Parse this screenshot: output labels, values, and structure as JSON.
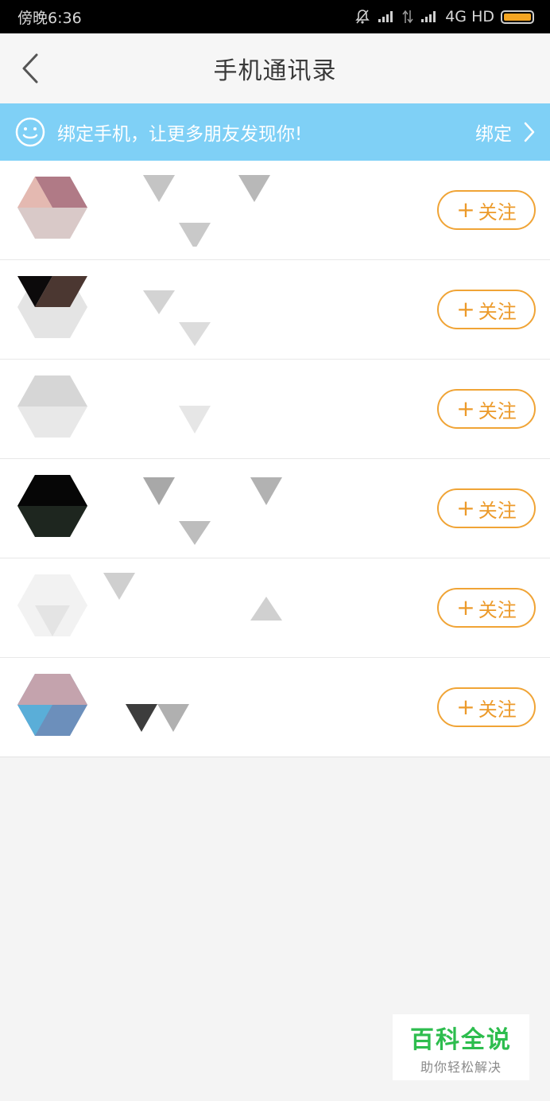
{
  "status_bar": {
    "time": "傍晚6:36",
    "network": "4G HD",
    "battery_color": "#f5a623"
  },
  "nav": {
    "title": "手机通讯录",
    "back_icon": "chevron-left-icon"
  },
  "banner": {
    "message": "绑定手机，让更多朋友发现你!",
    "action_label": "绑定",
    "icon": "smile-icon",
    "background": "#7fd0f6"
  },
  "contacts": [
    {
      "follow_label": "关注",
      "avatar_colors": [
        "#b07a86",
        "#e4b9b1",
        "#d9c9c8"
      ]
    },
    {
      "follow_label": "关注",
      "avatar_colors": [
        "#0c0a0b",
        "#4b3731",
        "#e4e4e4"
      ]
    },
    {
      "follow_label": "关注",
      "avatar_colors": [
        "#c7c7c7",
        "#dcdcdc",
        "#e8e8e8"
      ]
    },
    {
      "follow_label": "关注",
      "avatar_colors": [
        "#060606",
        "#1e261f",
        "#e6e6e6"
      ]
    },
    {
      "follow_label": "关注",
      "avatar_colors": [
        "#f2f2f2",
        "#e4e4e4",
        "#ededed"
      ]
    },
    {
      "follow_label": "关注",
      "avatar_colors": [
        "#c4a3ad",
        "#5aaed8",
        "#6c8fbb"
      ]
    }
  ],
  "accent_color": "#ec9a2a",
  "watermark": {
    "title": "百科全说",
    "subtitle": "助你轻松解决"
  }
}
